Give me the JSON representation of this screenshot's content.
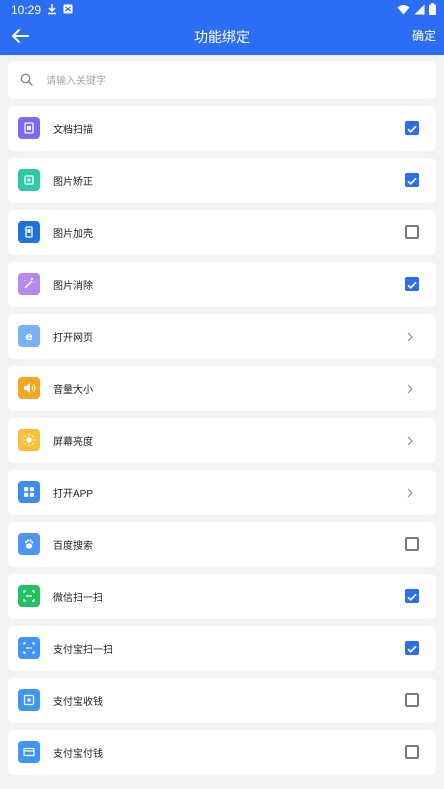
{
  "status_bar": {
    "time": "10:29"
  },
  "header": {
    "title": "功能绑定",
    "confirm_label": "确定"
  },
  "search": {
    "placeholder": "请输入关键字",
    "value": ""
  },
  "colors": {
    "accent": "#2b6ef3"
  },
  "items": [
    {
      "label": "文档扫描",
      "icon": "document-scan-icon",
      "color": "#7b6bf0",
      "control": "checkbox",
      "checked": true
    },
    {
      "label": "图片矫正",
      "icon": "image-correct-icon",
      "color": "#2fc9a6",
      "control": "checkbox",
      "checked": true
    },
    {
      "label": "图片加壳",
      "icon": "phone-shell-icon",
      "color": "#1f74d8",
      "control": "checkbox",
      "checked": false
    },
    {
      "label": "图片消除",
      "icon": "magic-wand-icon",
      "color": "#b58af0",
      "control": "checkbox",
      "checked": true
    },
    {
      "label": "打开网页",
      "icon": "browser-icon",
      "color": "#79b1f5",
      "control": "chevron"
    },
    {
      "label": "音量大小",
      "icon": "volume-icon",
      "color": "#f6a623",
      "control": "chevron"
    },
    {
      "label": "屏幕亮度",
      "icon": "brightness-icon",
      "color": "#f7bf3a",
      "control": "chevron"
    },
    {
      "label": "打开APP",
      "icon": "app-grid-icon",
      "color": "#3d8cf0",
      "control": "chevron"
    },
    {
      "label": "百度搜索",
      "icon": "baidu-icon",
      "color": "#4e94f5",
      "control": "checkbox",
      "checked": false
    },
    {
      "label": "微信扫一扫",
      "icon": "wechat-scan-icon",
      "color": "#21c361",
      "control": "checkbox",
      "checked": true
    },
    {
      "label": "支付宝扫一扫",
      "icon": "alipay-scan-icon",
      "color": "#3f95f5",
      "control": "checkbox",
      "checked": true
    },
    {
      "label": "支付宝收钱",
      "icon": "alipay-receive-icon",
      "color": "#3f95f5",
      "control": "checkbox",
      "checked": false
    },
    {
      "label": "支付宝付钱",
      "icon": "alipay-pay-icon",
      "color": "#3f95f5",
      "control": "checkbox",
      "checked": false
    }
  ]
}
